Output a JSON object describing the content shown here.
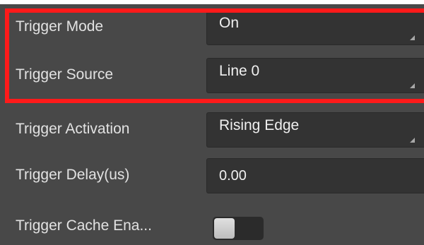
{
  "properties": [
    {
      "label": "Trigger Mode",
      "value": "On",
      "control": "dropdown"
    },
    {
      "label": "Trigger Source",
      "value": "Line 0",
      "control": "dropdown"
    },
    {
      "label": "Trigger Activation",
      "value": "Rising Edge",
      "control": "dropdown"
    },
    {
      "label": "Trigger Delay(us)",
      "value": "0.00",
      "control": "text-input"
    },
    {
      "label": "Trigger Cache Ena...",
      "value": "off",
      "control": "toggle"
    }
  ],
  "colors": {
    "panel_background": "#484848",
    "field_background": "#333333",
    "label_text": "#e2e2e2",
    "highlight": "#ff1a1a"
  }
}
